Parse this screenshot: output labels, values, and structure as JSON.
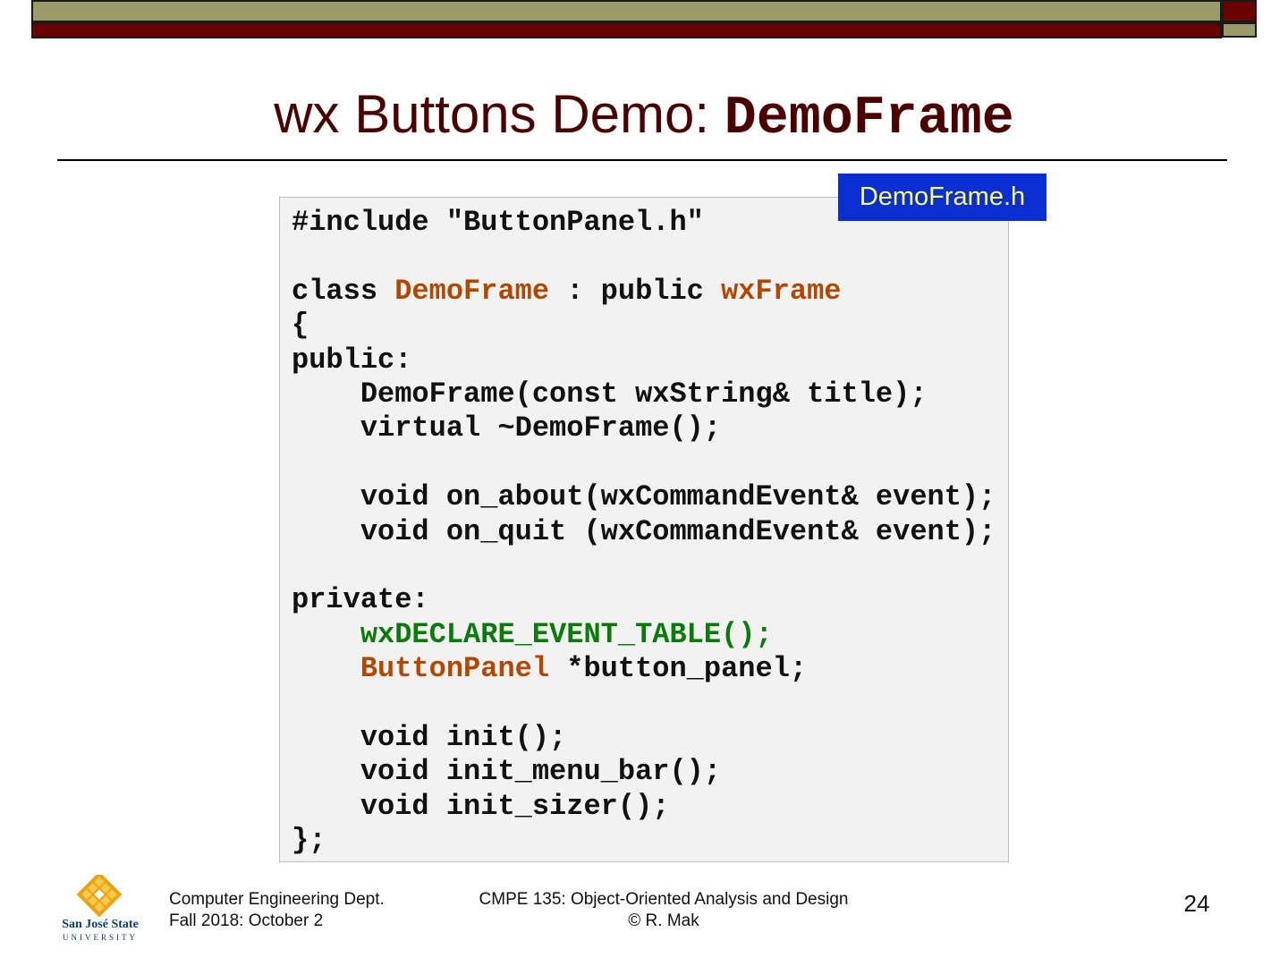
{
  "header": {
    "title_prefix": "wx Buttons Demo: ",
    "title_code": "DemoFrame"
  },
  "file_tag": "DemoFrame.h",
  "code_lines": [
    [
      {
        "t": "#include \"ButtonPanel.h\"",
        "c": "plain"
      }
    ],
    [
      {
        "t": "",
        "c": "plain"
      }
    ],
    [
      {
        "t": "class ",
        "c": "plain"
      },
      {
        "t": "DemoFrame",
        "c": "type"
      },
      {
        "t": " : public ",
        "c": "plain"
      },
      {
        "t": "wxFrame",
        "c": "type"
      }
    ],
    [
      {
        "t": "{",
        "c": "plain"
      }
    ],
    [
      {
        "t": "public:",
        "c": "plain"
      }
    ],
    [
      {
        "t": "    DemoFrame(const wxString& title);",
        "c": "plain"
      }
    ],
    [
      {
        "t": "    virtual ~DemoFrame();",
        "c": "plain"
      }
    ],
    [
      {
        "t": "",
        "c": "plain"
      }
    ],
    [
      {
        "t": "    void on_about(wxCommandEvent& event);",
        "c": "plain"
      }
    ],
    [
      {
        "t": "    void on_quit (wxCommandEvent& event);",
        "c": "plain"
      }
    ],
    [
      {
        "t": "",
        "c": "plain"
      }
    ],
    [
      {
        "t": "private:",
        "c": "plain"
      }
    ],
    [
      {
        "t": "    ",
        "c": "plain"
      },
      {
        "t": "wxDECLARE_EVENT_TABLE();",
        "c": "macro"
      }
    ],
    [
      {
        "t": "    ",
        "c": "plain"
      },
      {
        "t": "ButtonPanel",
        "c": "type"
      },
      {
        "t": " *button_panel;",
        "c": "plain"
      }
    ],
    [
      {
        "t": "",
        "c": "plain"
      }
    ],
    [
      {
        "t": "    void init();",
        "c": "plain"
      }
    ],
    [
      {
        "t": "    void init_menu_bar();",
        "c": "plain"
      }
    ],
    [
      {
        "t": "    void init_sizer();",
        "c": "plain"
      }
    ],
    [
      {
        "t": "};",
        "c": "plain"
      }
    ]
  ],
  "colors": {
    "title": "#4a0000",
    "type": "#b34700",
    "macro": "#0a7a0a",
    "file_tag_bg": "#0a2fd0",
    "file_tag_text": "#ffff66"
  },
  "logo": {
    "name": "San José State",
    "sub": "UNIVERSITY",
    "icon": "sjsu-logo-icon"
  },
  "footer": {
    "left_line1": "Computer Engineering Dept.",
    "left_line2": "Fall 2018: October 2",
    "center_line1": "CMPE 135: Object-Oriented Analysis and Design",
    "center_line2": "© R. Mak",
    "page_number": "24"
  }
}
